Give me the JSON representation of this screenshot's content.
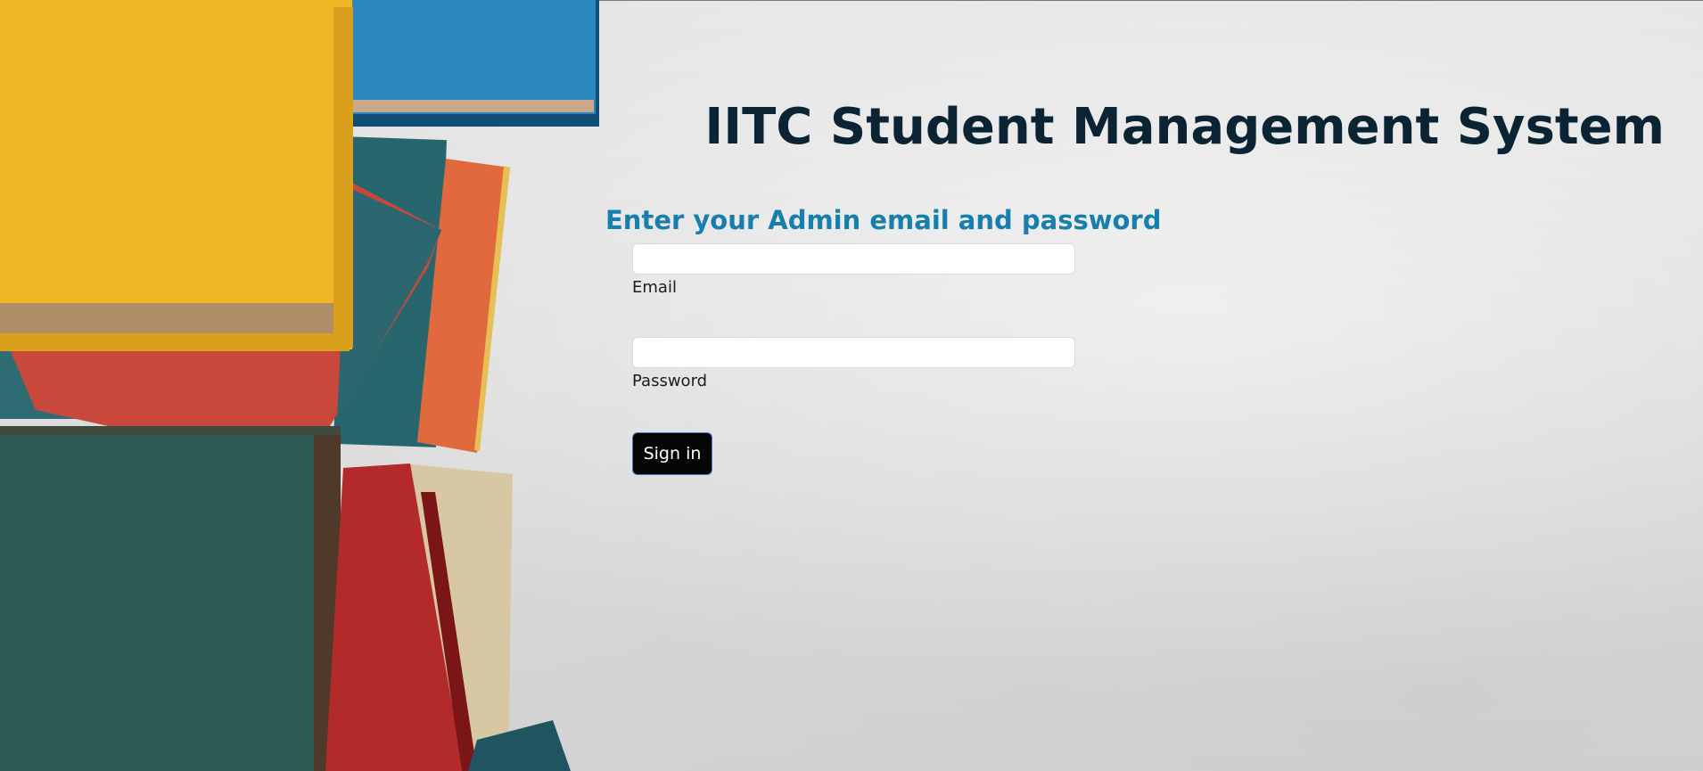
{
  "header": {
    "title": "IITC Student Management System"
  },
  "login": {
    "heading": "Enter your Admin email and password",
    "email_label": "Email",
    "email_value": "",
    "password_label": "Password",
    "password_value": "",
    "submit_label": "Sign in"
  },
  "theme": {
    "title_color": "#0b2433",
    "heading_color": "#177fae",
    "button_color": "#050505"
  },
  "decoration": {
    "illustration": "books-stack-illustration"
  }
}
